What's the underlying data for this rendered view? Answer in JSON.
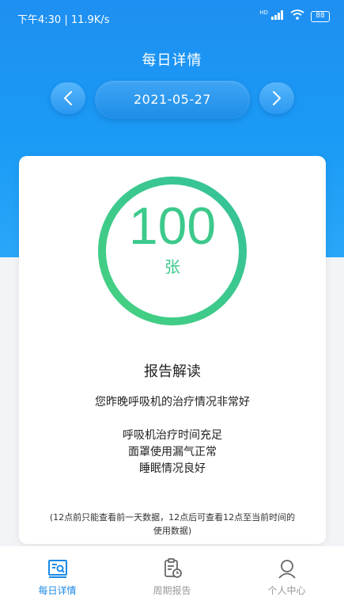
{
  "status_bar": {
    "time_speed": "下午4:30 | 11.9K/s",
    "network_badge": "HD",
    "battery": "88",
    "icons": [
      "signal-icon",
      "wifi-icon",
      "battery-icon"
    ]
  },
  "header": {
    "title": "每日详情",
    "date": "2021-05-27",
    "prev_icon": "chevron-left-icon",
    "next_icon": "chevron-right-icon"
  },
  "score": {
    "value": "100",
    "unit": "张",
    "progress_fraction": 1.0,
    "ring_color": "#3cc98b"
  },
  "report": {
    "title": "报告解读",
    "summary": "您昨晚呼吸机的治疗情况非常好",
    "lines": [
      "呼吸机治疗时间充足",
      "面罩使用漏气正常",
      "睡眠情况良好"
    ],
    "note_line1": "(12点前只能查看前一天数据，12点后可查看12点至当前时间的",
    "note_line2": "使用数据)"
  },
  "tabs": [
    {
      "label": "每日详情",
      "icon": "daily-report-icon",
      "active": true
    },
    {
      "label": "周期报告",
      "icon": "clipboard-clock-icon",
      "active": false
    },
    {
      "label": "个人中心",
      "icon": "person-icon",
      "active": false
    }
  ],
  "colors": {
    "accent": "#1b8ae6",
    "hero": "#1e8ff2",
    "inactive": "#999999"
  }
}
